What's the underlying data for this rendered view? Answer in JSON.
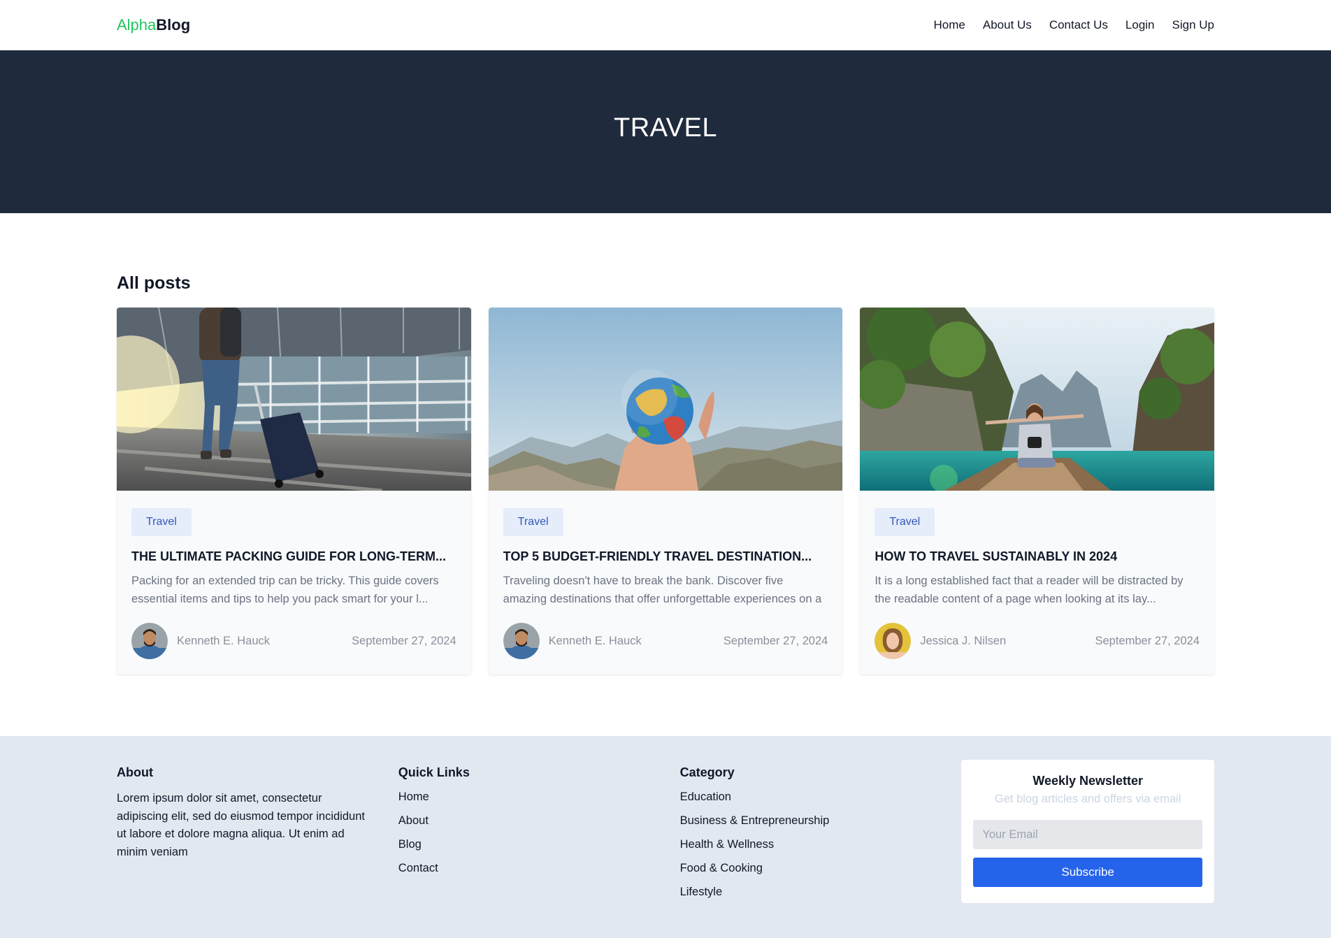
{
  "nav": {
    "logo_alpha": "Alpha",
    "logo_blog": "Blog",
    "links": [
      "Home",
      "About Us",
      "Contact Us",
      "Login",
      "Sign Up"
    ]
  },
  "hero": {
    "title": "TRAVEL"
  },
  "posts": {
    "heading": "All posts",
    "cards": [
      {
        "image_icon": "airport-traveler-with-suitcase-image",
        "tag": "Travel",
        "title": "THE ULTIMATE PACKING GUIDE FOR LONG-TERM...",
        "excerpt": "Packing for an extended trip can be tricky. This guide covers essential items and tips to help you pack smart for your l...",
        "author": "Kenneth E. Hauck",
        "date": "September 27, 2024"
      },
      {
        "image_icon": "hand-holding-globe-image",
        "tag": "Travel",
        "title": "TOP 5 BUDGET-FRIENDLY TRAVEL DESTINATION...",
        "excerpt": "Traveling doesn't have to break the bank. Discover five amazing destinations that offer unforgettable experiences on a b...",
        "author": "Kenneth E. Hauck",
        "date": "September 27, 2024"
      },
      {
        "image_icon": "woman-on-boat-lagoon-image",
        "tag": "Travel",
        "title": "HOW TO TRAVEL SUSTAINABLY IN 2024",
        "excerpt": "It is a long established fact that a reader will be distracted by the readable content of a page when looking at its lay...",
        "author": "Jessica J. Nilsen",
        "date": "September 27, 2024"
      }
    ]
  },
  "footer": {
    "about": {
      "heading": "About",
      "text": "Lorem ipsum dolor sit amet, consectetur adipiscing elit, sed do eiusmod tempor incididunt ut labore et dolore magna aliqua. Ut enim ad minim veniam"
    },
    "quick_links": {
      "heading": "Quick Links",
      "items": [
        "Home",
        "About",
        "Blog",
        "Contact"
      ]
    },
    "category": {
      "heading": "Category",
      "items": [
        "Education",
        "Business & Entrepreneurship",
        "Health & Wellness",
        "Food & Cooking",
        "Lifestyle"
      ]
    },
    "newsletter": {
      "heading": "Weekly Newsletter",
      "subtitle": "Get blog articles and offers via email",
      "email_placeholder": "Your Email",
      "button": "Subscribe"
    }
  },
  "colors": {
    "accent_green": "#22c55e",
    "hero_bg": "#1f2a3c",
    "button_blue": "#2563eb",
    "footer_bg": "#e2e8f0",
    "tag_bg": "#e5edfb",
    "tag_text": "#3159b8"
  }
}
